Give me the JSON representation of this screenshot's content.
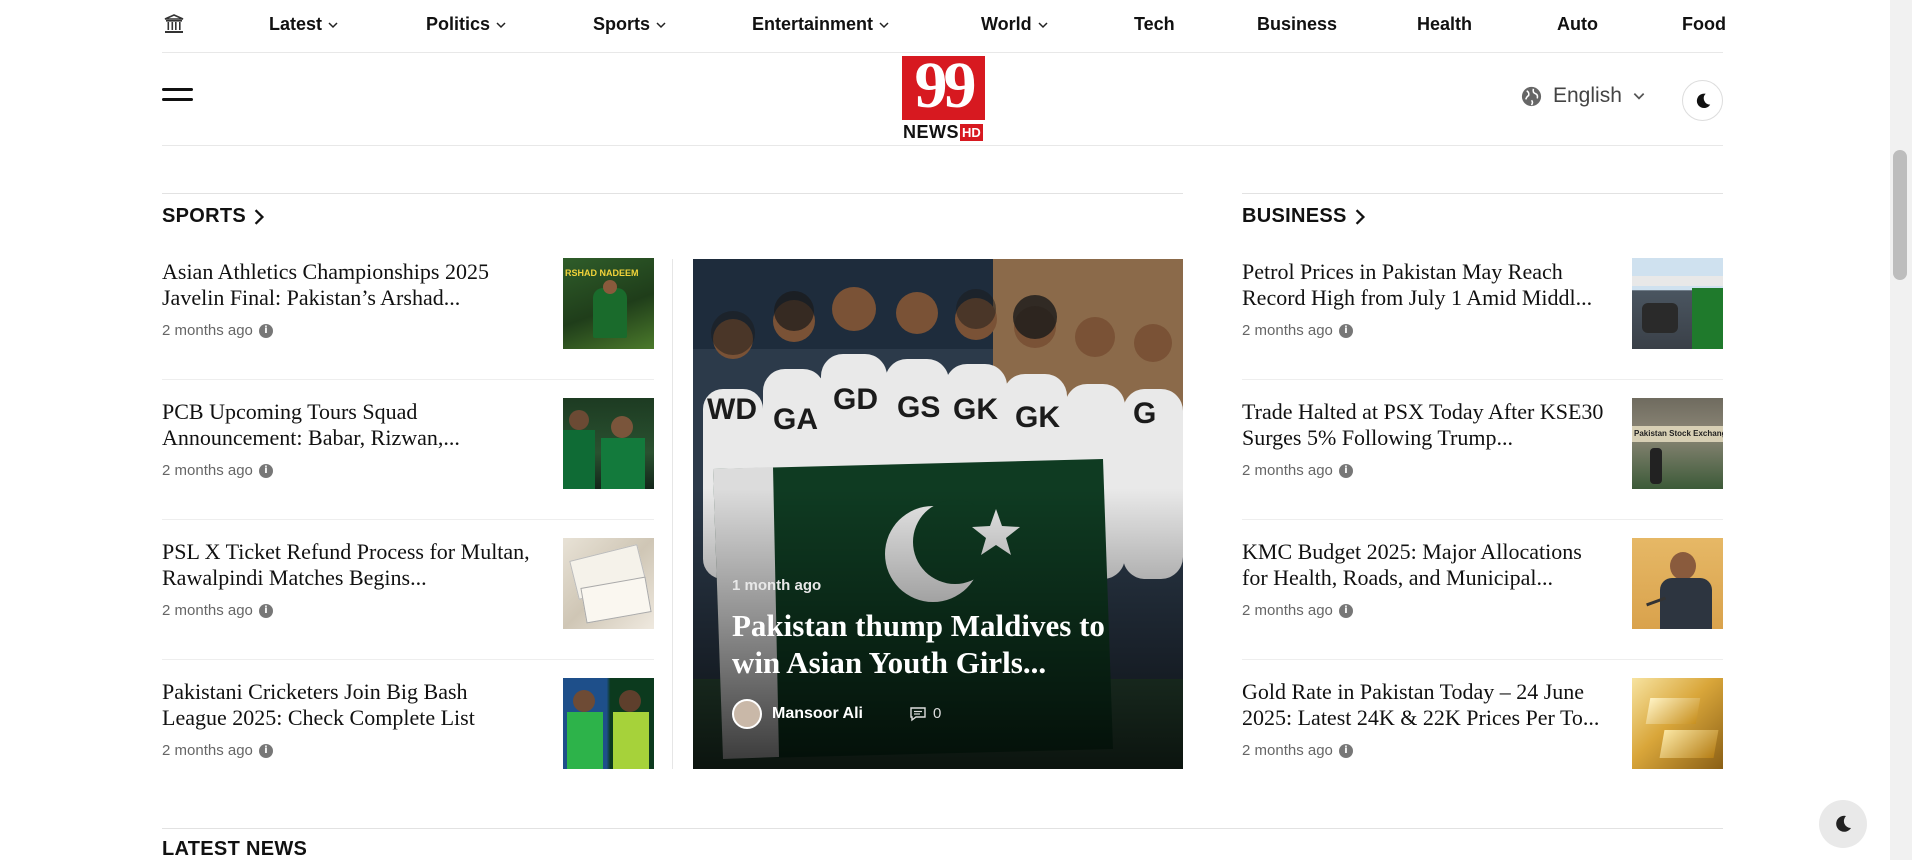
{
  "nav": {
    "home_icon": "museum-icon",
    "items": [
      {
        "label": "Latest",
        "dropdown": true
      },
      {
        "label": "Politics",
        "dropdown": true
      },
      {
        "label": "Sports",
        "dropdown": true
      },
      {
        "label": "Entertainment",
        "dropdown": true
      },
      {
        "label": "World",
        "dropdown": true
      },
      {
        "label": "Tech",
        "dropdown": false
      },
      {
        "label": "Business",
        "dropdown": false
      },
      {
        "label": "Health",
        "dropdown": false
      },
      {
        "label": "Auto",
        "dropdown": false
      },
      {
        "label": "Food",
        "dropdown": false
      }
    ]
  },
  "header": {
    "logo_text": "99",
    "logo_sub": "NEWS",
    "logo_badge": "HD",
    "language": "English"
  },
  "sports": {
    "title": "SPORTS",
    "items": [
      {
        "title": "Asian Athletics Championships 2025 Javelin Final: Pakistan’s Arshad...",
        "time": "2 months ago",
        "thumb_text": "RSHAD NADEEM"
      },
      {
        "title": "PCB Upcoming Tours Squad Announcement: Babar, Rizwan,...",
        "time": "2 months ago"
      },
      {
        "title": "PSL X Ticket Refund Process for Multan, Rawalpindi Matches Begins...",
        "time": "2 months ago"
      },
      {
        "title": "Pakistani Cricketers Join Big Bash League 2025: Check Complete List",
        "time": "2 months ago"
      }
    ]
  },
  "feature": {
    "time": "1 month ago",
    "title": "Pakistan thump Maldives to win Asian Youth Girls...",
    "author": "Mansoor Ali",
    "comments": "0",
    "jersey_labels": [
      "WD",
      "GA",
      "GD",
      "GS",
      "GK",
      "GK",
      "G"
    ]
  },
  "business": {
    "title": "BUSINESS",
    "items": [
      {
        "title": "Petrol Prices in Pakistan May Reach Record High from July 1 Amid Middl...",
        "time": "2 months ago"
      },
      {
        "title": "Trade Halted at PSX Today After KSE30 Surges 5% Following Trump...",
        "time": "2 months ago",
        "thumb_text": "Pakistan Stock Exchange"
      },
      {
        "title": "KMC Budget 2025: Major Allocations for Health, Roads, and Municipal...",
        "time": "2 months ago"
      },
      {
        "title": "Gold Rate in Pakistan Today – 24 June 2025: Latest 24K & 22K Prices Per To...",
        "time": "2 months ago"
      }
    ]
  },
  "latest": {
    "title": "LATEST NEWS"
  },
  "colors": {
    "brand_red": "#d71920",
    "text": "#111111",
    "muted": "#666666"
  }
}
